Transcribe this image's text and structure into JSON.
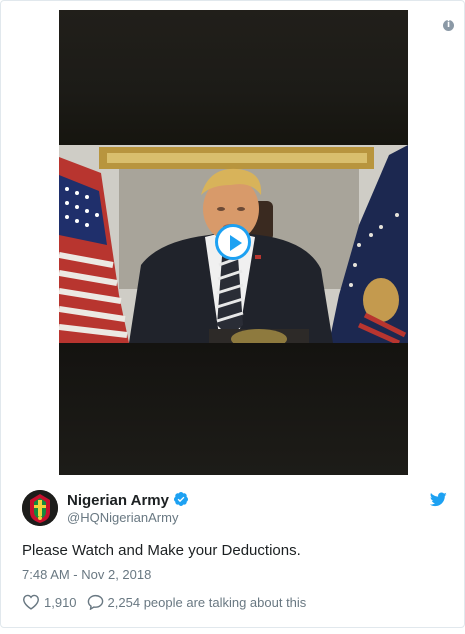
{
  "tweet": {
    "author_name": "Nigerian Army",
    "author_handle": "@HQNigerianArmy",
    "text": "Please Watch and Make your Deductions.",
    "timestamp": "7:48 AM - Nov 2, 2018",
    "likes": "1,910",
    "talking": "2,254 people are talking about this"
  },
  "icons": {
    "info": "info-icon",
    "play": "play-icon",
    "verified": "verified-badge-icon",
    "bird": "twitter-bird-icon",
    "heart": "heart-icon",
    "reply": "speech-bubble-icon"
  },
  "colors": {
    "accent": "#1da1f2",
    "text": "#1c2022",
    "muted": "#697882",
    "border": "#e1e8ed"
  }
}
